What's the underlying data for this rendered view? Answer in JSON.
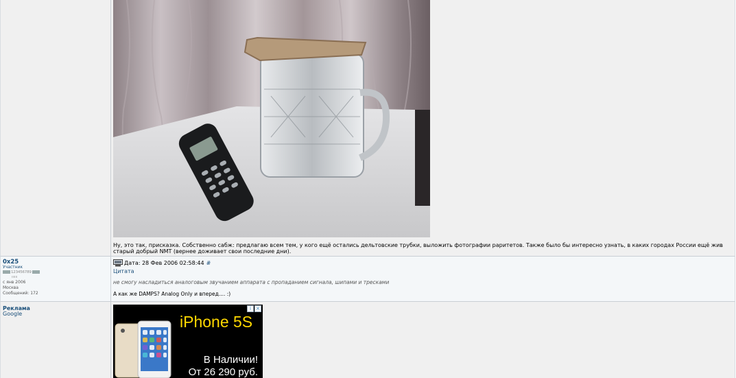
{
  "post1": {
    "text": "Ну, это так, присказка. Собственно сабж: предлагаю всем тем, у кого ещё остались дельтовские трубки, выложить фотографии раритетов. Также было бы интересно узнать, в каких городах России ещё жив старый добрый NMT (вернее доживает свои последние дни)."
  },
  "post2": {
    "user": {
      "name": "0x25",
      "rank": "Участник",
      "stars": "123456789",
      "since": "с янв 2006",
      "city": "Москва",
      "posts": "Сообщений: 172"
    },
    "date_label": "Дата: 28 Фев 2006 02:58:44",
    "anchor": "#",
    "quote_label": "Цитата",
    "quote_text": "не смогу насладиться аналоговым звучанием аппарата с пропаданием сигнала, шипами и тресками",
    "reply_text": "А как же DAMPS? Analog Only и вперед.... :)"
  },
  "ad": {
    "title": "Реклама",
    "subtitle": "Google",
    "headline": "iPhone 5S",
    "line1": "В Наличии!",
    "line2": "От 26 290 руб."
  }
}
